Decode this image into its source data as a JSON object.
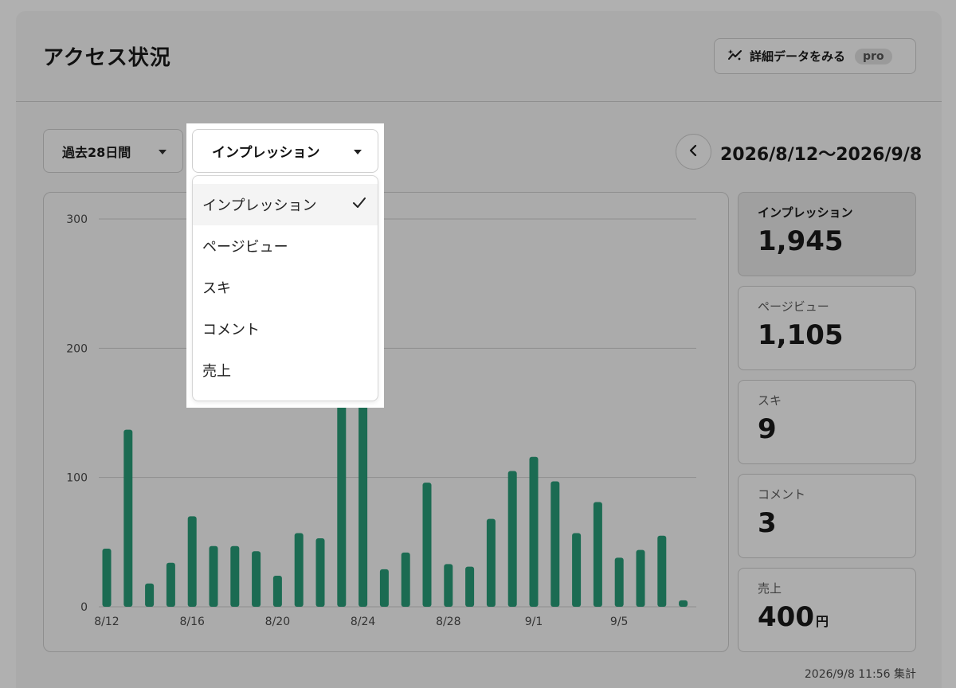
{
  "header": {
    "title": "アクセス状況",
    "detail_button": {
      "label": "詳細データをみる",
      "badge": "pro"
    }
  },
  "controls": {
    "period": {
      "selected": "過去28日間"
    },
    "metric": {
      "selected": "インプレッション",
      "options": [
        "インプレッション",
        "ページビュー",
        "スキ",
        "コメント",
        "売上"
      ]
    },
    "date_range": "2026/8/12〜2026/9/8"
  },
  "stats": [
    {
      "label": "インプレッション",
      "value": "1,945",
      "unit": ""
    },
    {
      "label": "ページビュー",
      "value": "1,105",
      "unit": ""
    },
    {
      "label": "スキ",
      "value": "9",
      "unit": ""
    },
    {
      "label": "コメント",
      "value": "3",
      "unit": ""
    },
    {
      "label": "売上",
      "value": "400",
      "unit": "円"
    }
  ],
  "footer": {
    "timestamp": "2026/9/8 11:56 集計"
  },
  "colors": {
    "bar": "#1b6b52",
    "gridline": "#8f8f8f"
  },
  "icons": {
    "detail": "sparkle-chart-icon",
    "prev": "chevron-left-icon",
    "check": "check-icon"
  },
  "chart_data": {
    "type": "bar",
    "categories": [
      "8/12",
      "8/13",
      "8/14",
      "8/15",
      "8/16",
      "8/17",
      "8/18",
      "8/19",
      "8/20",
      "8/21",
      "8/22",
      "8/23",
      "8/24",
      "8/25",
      "8/26",
      "8/27",
      "8/28",
      "8/29",
      "8/30",
      "8/31",
      "9/1",
      "9/2",
      "9/3",
      "9/4",
      "9/5",
      "9/6",
      "9/7",
      "9/8"
    ],
    "tick_labels": [
      "8/12",
      "8/16",
      "8/20",
      "8/24",
      "8/28",
      "9/1",
      "9/5"
    ],
    "values": [
      45,
      137,
      18,
      34,
      70,
      47,
      47,
      43,
      24,
      57,
      53,
      230,
      230,
      29,
      42,
      96,
      33,
      31,
      68,
      105,
      116,
      97,
      57,
      81,
      38,
      44,
      55,
      5
    ],
    "ylim": [
      0,
      300
    ],
    "yticks": [
      0,
      100,
      200,
      300
    ],
    "grid": true
  }
}
